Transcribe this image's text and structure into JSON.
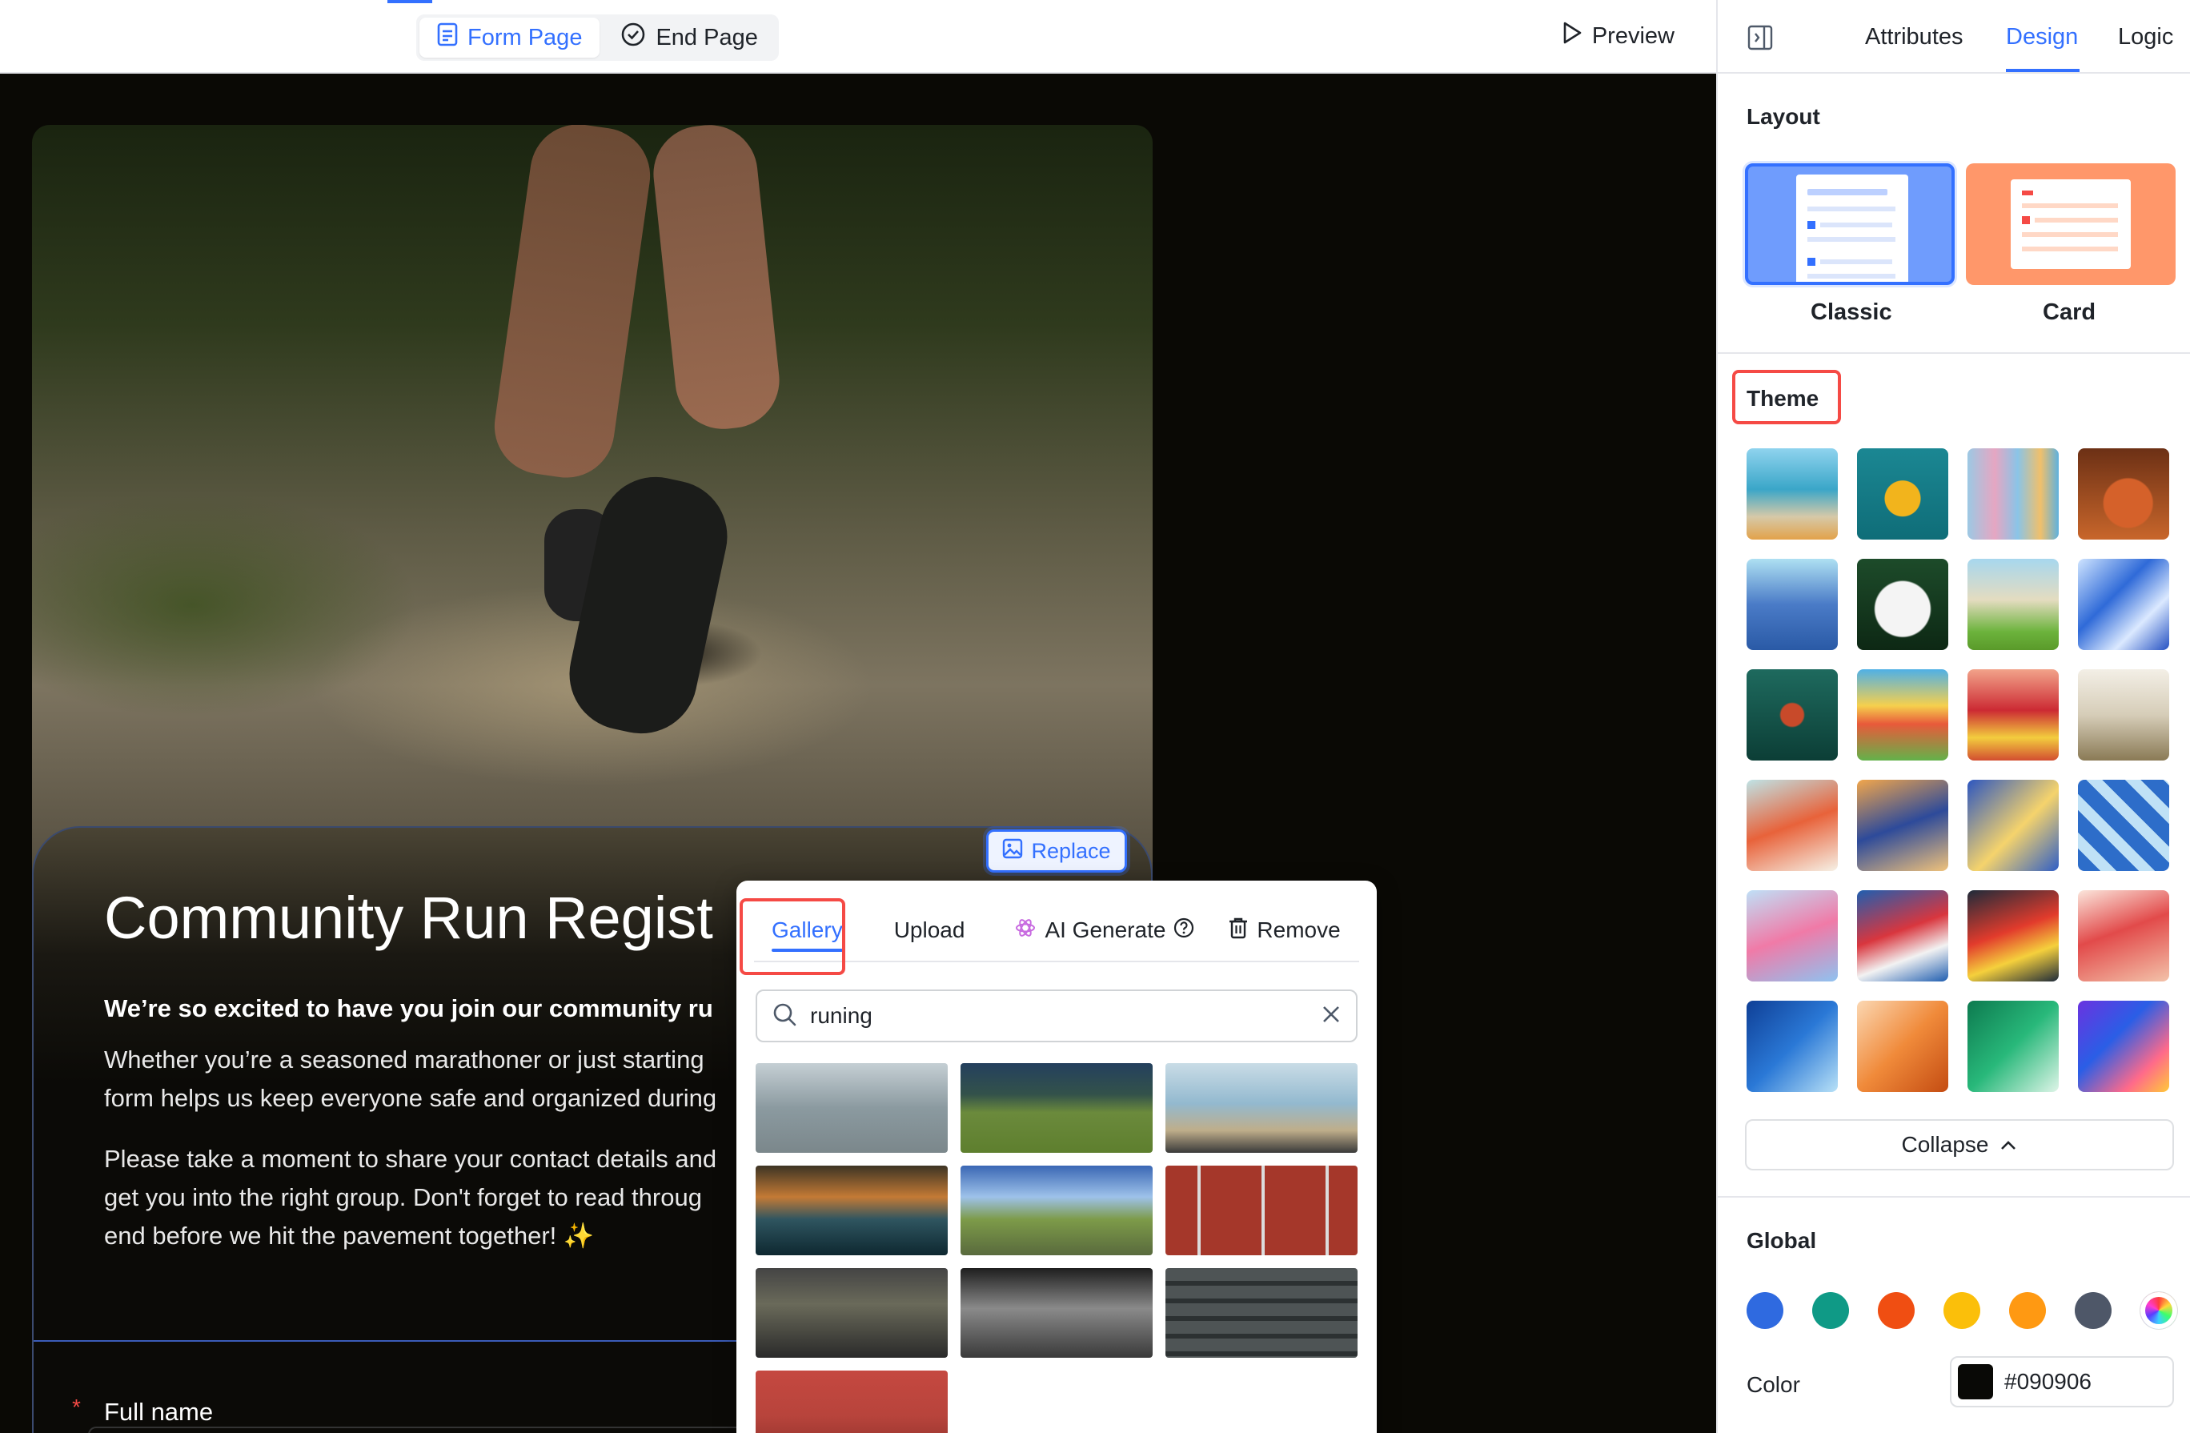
{
  "topbar": {
    "tabs": [
      {
        "label": "Form Page",
        "icon": "document-icon",
        "active": true
      },
      {
        "label": "End Page",
        "icon": "check-circle-icon",
        "active": false
      }
    ],
    "preview_label": "Preview"
  },
  "form": {
    "title": "Community Run Regist",
    "lead": "We’re so excited to have you join our community ru",
    "paragraphs": [
      [
        "Whether you’re a seasoned marathoner or just starting",
        "form helps us keep everyone safe and organized during"
      ],
      [
        "Please take a moment to share your contact details and",
        "get you into the right group. Don't forget to read throug",
        "end before we hit the pavement together! ✨"
      ]
    ],
    "field_label": "Full name",
    "required_marker": "*",
    "replace_label": "Replace"
  },
  "popover": {
    "tabs": [
      "Gallery",
      "Upload",
      "AI Generate",
      "Remove"
    ],
    "active_tab": "Gallery",
    "search_value": "runing",
    "thumbnail_count": 10
  },
  "panel": {
    "tabs": [
      "Attributes",
      "Design",
      "Logic"
    ],
    "active_tab": "Design",
    "layout_title": "Layout",
    "layouts": [
      {
        "label": "Classic",
        "color": "#6f9cfd",
        "selected": true
      },
      {
        "label": "Card",
        "color": "#ff976a",
        "selected": false
      }
    ],
    "theme_title": "Theme",
    "collapse_label": "Collapse",
    "global_title": "Global",
    "swatches": [
      "#2f6ae0",
      "#0f9a86",
      "#f04e12",
      "#fbbf0a",
      "#ff9912",
      "#4e5768",
      "conic"
    ],
    "color_label": "Color",
    "color_value": "#090906",
    "color_hex": "#090906"
  },
  "colors": {
    "accent": "#3370ff",
    "highlight": "#f54a45"
  }
}
